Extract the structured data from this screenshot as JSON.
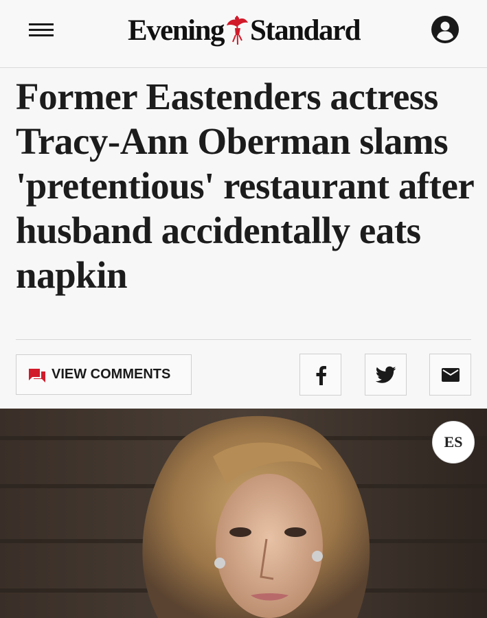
{
  "header": {
    "logo_left": "Evening",
    "logo_right": "Standard",
    "menu_icon": "hamburger-menu-icon",
    "account_icon": "account-circle-icon"
  },
  "article": {
    "headline": "Former Eastenders actress Tracy-Ann Oberman slams 'pretentious' restaurant after husband accidentally eats napkin"
  },
  "actions": {
    "comments_label": "VIEW COMMENTS",
    "comments_icon": "comment-icon",
    "share_facebook_icon": "facebook-icon",
    "share_twitter_icon": "twitter-icon",
    "share_email_icon": "email-icon"
  },
  "media": {
    "badge_text": "ES"
  },
  "colors": {
    "accent_red": "#d11a2a",
    "text": "#1c1c1c",
    "background": "#f7f7f7"
  }
}
